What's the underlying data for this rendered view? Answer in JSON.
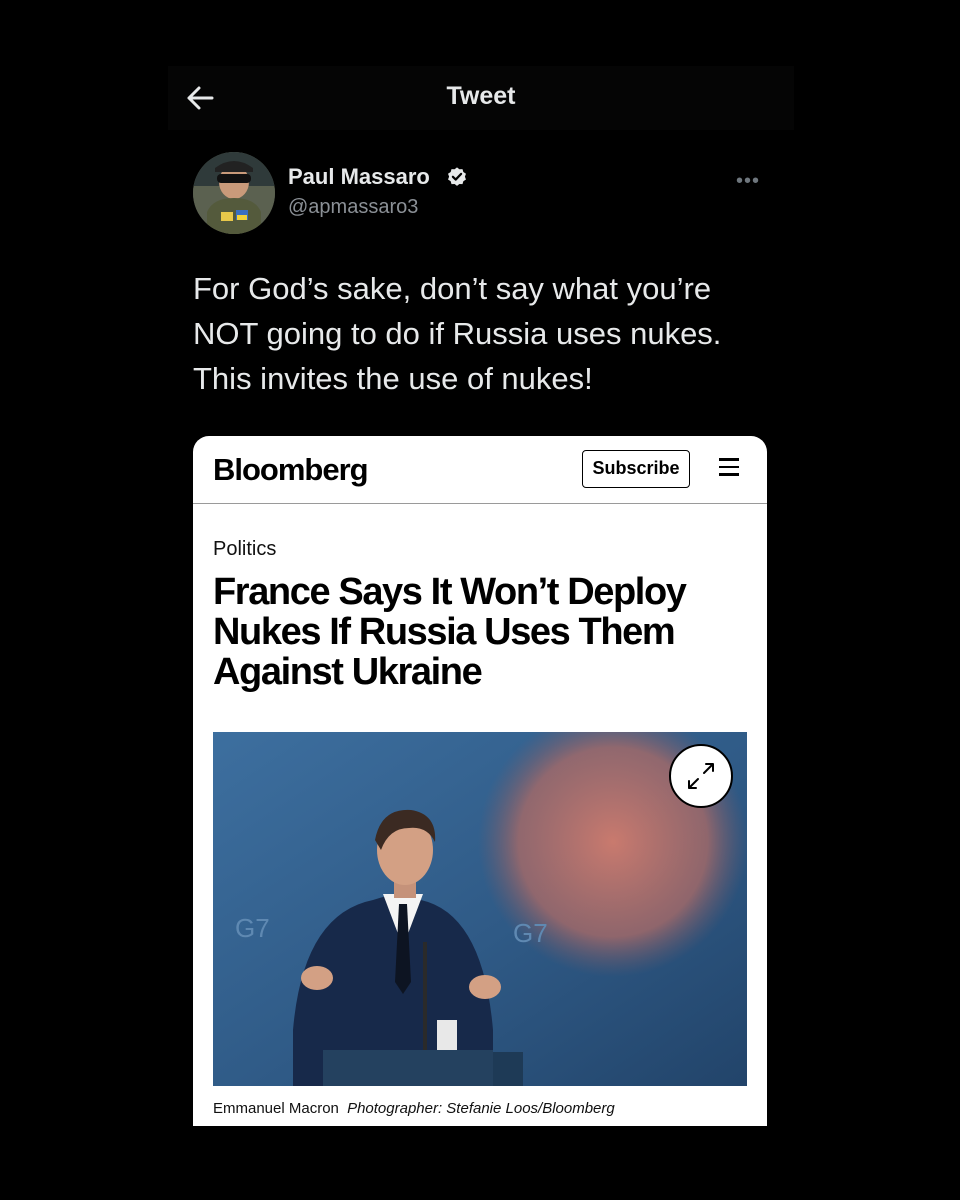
{
  "header": {
    "title": "Tweet",
    "back_icon": "back-arrow-icon"
  },
  "author": {
    "name": "Paul Massaro",
    "handle": "@apmassaro3",
    "verified_icon": "verified-badge-icon",
    "more_label": "•••"
  },
  "tweet": {
    "lines": [
      "For God’s sake, don’t say what you’re",
      "NOT going to do if Russia uses nukes.",
      "This invites the use of nukes!"
    ]
  },
  "article": {
    "brand": "Bloomberg",
    "subscribe_label": "Subscribe",
    "menu_icon": "hamburger-menu-icon",
    "section": "Politics",
    "headline_lines": [
      "France Says It Won’t Deploy",
      "Nukes If Russia Uses Them",
      "Against Ukraine"
    ],
    "expand_icon": "expand-icon",
    "caption_name": "Emmanuel Macron",
    "caption_credit": "Photographer: Stefanie Loos/Bloomberg"
  },
  "colors": {
    "background": "#000000",
    "text_primary": "#e7e9ea",
    "text_secondary": "#8b9096",
    "card_background": "#ffffff"
  }
}
